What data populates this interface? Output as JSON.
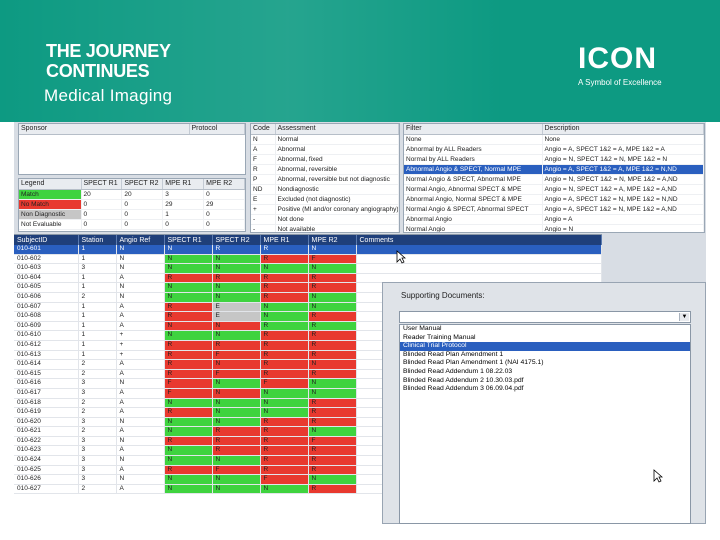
{
  "header": {
    "title_line1": "THE JOURNEY",
    "title_line2": "CONTINUES",
    "subtitle": "Medical Imaging",
    "logo": "ICON",
    "logo_tagline": "A Symbol of Excellence",
    "bg_color": "#0d9a82"
  },
  "sponsor_pane": {
    "col1": "Sponsor",
    "col2": "Protocol"
  },
  "code_pane": {
    "headers": [
      "Code",
      "Assessment"
    ],
    "rows": [
      [
        "N",
        "Normal"
      ],
      [
        "A",
        "Abnormal"
      ],
      [
        "F",
        "Abnormal, fixed"
      ],
      [
        "R",
        "Abnormal, reversible"
      ],
      [
        "P",
        "Abnormal, reversible but not diagnostic"
      ],
      [
        "ND",
        "Nondiagnostic"
      ],
      [
        "E",
        "Excluded (not diagnostic)"
      ],
      [
        "+",
        "Positive (MI and/or coronary angiography)"
      ],
      [
        "-",
        "Not done"
      ],
      [
        "-",
        "Not available"
      ],
      [
        "n/a",
        "Not applicable"
      ],
      [
        "X",
        "Excluded from clinical outcomes"
      ]
    ]
  },
  "legend_pane": {
    "headers": [
      "Legend",
      "SPECT R1",
      "SPECT R2",
      "MPE R1",
      "MPE R2"
    ],
    "rows": [
      [
        "Match",
        "20",
        "20",
        "3",
        "0"
      ],
      [
        "No Match",
        "0",
        "0",
        "29",
        "29"
      ],
      [
        "Non Diagnostic",
        "0",
        "0",
        "1",
        "0"
      ],
      [
        "Not Evaluable",
        "0",
        "0",
        "0",
        "0"
      ]
    ],
    "label_colors": [
      "#3fd33f",
      "#e8392f",
      "#c6c6c6",
      "#ffffff"
    ]
  },
  "filter_pane": {
    "headers": [
      "Filter",
      "Description"
    ],
    "rows": [
      [
        "None",
        "None"
      ],
      [
        "Abnormal by ALL Readers",
        "Angio = A, SPECT 1&2 = A, MPE 1&2 = A"
      ],
      [
        "Normal by ALL Readers",
        "Angio = N, SPECT 1&2 = N, MPE 1&2 = N"
      ],
      [
        "Abnormal Angio & SPECT, Normal MPE",
        "Angio = A, SPECT 1&2 = A, MPE 1&2 = N,ND"
      ],
      [
        "Normal Angio & SPECT, Abnormal MPE",
        "Angio = N, SPECT 1&2 = N, MPE 1&2 = A,ND"
      ],
      [
        "Normal Angio, Abnormal SPECT & MPE",
        "Angio = N, SPECT 1&2 = A, MPE 1&2 = A,ND"
      ],
      [
        "Abnormal Angio, Normal SPECT & MPE",
        "Angio = A, SPECT 1&2 = N, MPE 1&2 = N,ND"
      ],
      [
        "Normal Angio & SPECT, Abnormal SPECT",
        "Angio = A, SPECT 1&2 = N, MPE 1&2 = A,ND"
      ],
      [
        "Abnormal Angio",
        "Angio = A"
      ],
      [
        "Normal Angio",
        "Angio = N"
      ]
    ],
    "selected_index": 3
  },
  "grid": {
    "headers": [
      "SubjectID",
      "Station",
      "Angio Ref",
      "SPECT R1",
      "SPECT R2",
      "MPE R1",
      "MPE R2",
      "Comments"
    ],
    "selected_index": 0,
    "rows": [
      [
        "010-601",
        "1",
        "N",
        "N",
        "R",
        "R",
        "N"
      ],
      [
        "010-602",
        "1",
        "N",
        "N",
        "N",
        "R",
        "F"
      ],
      [
        "010-603",
        "3",
        "N",
        "N",
        "N",
        "N",
        "N"
      ],
      [
        "010-604",
        "1",
        "A",
        "R",
        "R",
        "R",
        "R"
      ],
      [
        "010-605",
        "1",
        "N",
        "N",
        "N",
        "R",
        "R"
      ],
      [
        "010-606",
        "2",
        "N",
        "N",
        "N",
        "R",
        "N"
      ],
      [
        "010-607",
        "1",
        "A",
        "R",
        "E",
        "N",
        "N"
      ],
      [
        "010-608",
        "1",
        "A",
        "R",
        "E",
        "N",
        "R"
      ],
      [
        "010-609",
        "1",
        "A",
        "N",
        "N",
        "R",
        "R"
      ],
      [
        "010-610",
        "1",
        "+",
        "N",
        "N",
        "R",
        "R"
      ],
      [
        "010-612",
        "1",
        "+",
        "R",
        "R",
        "R",
        "R"
      ],
      [
        "010-613",
        "1",
        "+",
        "R",
        "F",
        "R",
        "R"
      ],
      [
        "010-614",
        "2",
        "A",
        "R",
        "N",
        "R",
        "N"
      ],
      [
        "010-615",
        "2",
        "A",
        "R",
        "F",
        "R",
        "R"
      ],
      [
        "010-616",
        "3",
        "N",
        "F",
        "N",
        "F",
        "N"
      ],
      [
        "010-617",
        "3",
        "A",
        "F",
        "N",
        "N",
        "N"
      ],
      [
        "010-618",
        "2",
        "A",
        "N",
        "N",
        "N",
        "R"
      ],
      [
        "010-619",
        "2",
        "A",
        "R",
        "N",
        "N",
        "R"
      ],
      [
        "010-620",
        "3",
        "N",
        "N",
        "N",
        "R",
        "R"
      ],
      [
        "010-621",
        "2",
        "A",
        "N",
        "R",
        "R",
        "N"
      ],
      [
        "010-622",
        "3",
        "N",
        "R",
        "R",
        "R",
        "F"
      ],
      [
        "010-623",
        "3",
        "A",
        "N",
        "R",
        "R",
        "R"
      ],
      [
        "010-624",
        "3",
        "N",
        "N",
        "N",
        "R",
        "R"
      ],
      [
        "010-625",
        "3",
        "A",
        "R",
        "F",
        "R",
        "R"
      ],
      [
        "010-626",
        "3",
        "N",
        "N",
        "N",
        "F",
        "N"
      ],
      [
        "010-627",
        "2",
        "A",
        "N",
        "N",
        "N",
        "R"
      ]
    ],
    "row_colors": [
      [
        "g",
        "r",
        "r",
        "g"
      ],
      [
        "g",
        "g",
        "r",
        "r"
      ],
      [
        "g",
        "g",
        "g",
        "g"
      ],
      [
        "r",
        "r",
        "r",
        "r"
      ],
      [
        "g",
        "g",
        "r",
        "r"
      ],
      [
        "g",
        "g",
        "r",
        "g"
      ],
      [
        "r",
        "x",
        "g",
        "g"
      ],
      [
        "r",
        "x",
        "g",
        "r"
      ],
      [
        "r",
        "r",
        "g",
        "g"
      ],
      [
        "g",
        "g",
        "r",
        "r"
      ],
      [
        "r",
        "r",
        "r",
        "r"
      ],
      [
        "r",
        "r",
        "r",
        "r"
      ],
      [
        "r",
        "r",
        "r",
        "r"
      ],
      [
        "r",
        "r",
        "r",
        "r"
      ],
      [
        "r",
        "g",
        "r",
        "g"
      ],
      [
        "r",
        "r",
        "g",
        "g"
      ],
      [
        "g",
        "g",
        "g",
        "r"
      ],
      [
        "r",
        "g",
        "g",
        "r"
      ],
      [
        "g",
        "g",
        "r",
        "r"
      ],
      [
        "g",
        "r",
        "r",
        "g"
      ],
      [
        "r",
        "r",
        "r",
        "r"
      ],
      [
        "g",
        "r",
        "r",
        "r"
      ],
      [
        "g",
        "g",
        "r",
        "r"
      ],
      [
        "r",
        "r",
        "r",
        "r"
      ],
      [
        "g",
        "g",
        "r",
        "g"
      ],
      [
        "g",
        "g",
        "g",
        "r"
      ]
    ],
    "colors": {
      "match": "#3fd33f",
      "no_match": "#e8392f",
      "nondiagnostic": "#c6c6c6"
    }
  },
  "docs": {
    "title": "Supporting Documents:",
    "selected_index": 2,
    "items": [
      "User Manual",
      "Reader Training Manual",
      "Clinical Trial Protocol",
      "Blinded Read Plan Amendment 1",
      "Blinded Read Plan Amendment 1 (NAI 4175.1)",
      "Blinded Read Addendum 1 08.22.03",
      "Blinded Read Addendum 2 10.30.03.pdf",
      "Blinded Read Addendum 3 06.09.04.pdf"
    ]
  }
}
